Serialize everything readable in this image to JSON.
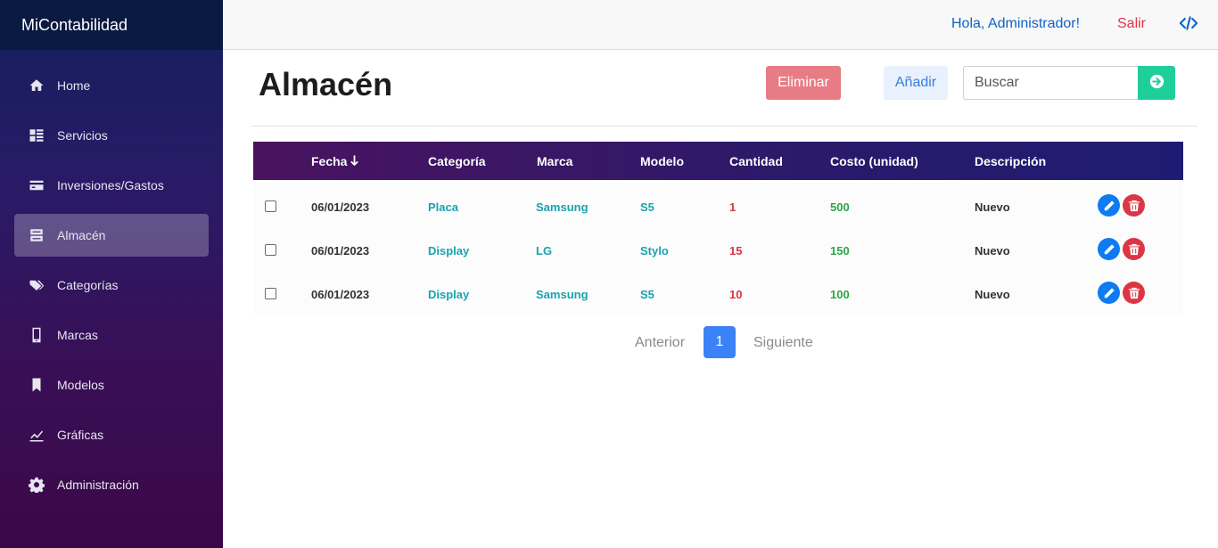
{
  "app": {
    "brand": "MiContabilidad"
  },
  "sidebar": {
    "items": [
      {
        "label": "Home",
        "icon": "home-icon"
      },
      {
        "label": "Servicios",
        "icon": "services-icon"
      },
      {
        "label": "Inversiones/Gastos",
        "icon": "card-icon"
      },
      {
        "label": "Almacén",
        "icon": "storage-icon",
        "active": true
      },
      {
        "label": "Categorías",
        "icon": "tags-icon"
      },
      {
        "label": "Marcas",
        "icon": "phone-icon"
      },
      {
        "label": "Modelos",
        "icon": "bookmark-icon"
      },
      {
        "label": "Gráficas",
        "icon": "chart-icon"
      },
      {
        "label": "Administración",
        "icon": "gear-icon"
      }
    ]
  },
  "topbar": {
    "greeting": "Hola, Administrador!",
    "logout": "Salir",
    "code_icon": "code-icon"
  },
  "page": {
    "title": "Almacén",
    "delete_label": "Eliminar",
    "add_label": "Añadir",
    "search_placeholder": "Buscar"
  },
  "table": {
    "headers": {
      "fecha": "Fecha",
      "categoria": "Categoría",
      "marca": "Marca",
      "modelo": "Modelo",
      "cantidad": "Cantidad",
      "costo": "Costo (unidad)",
      "descripcion": "Descripción"
    },
    "rows": [
      {
        "fecha": "06/01/2023",
        "categoria": "Placa",
        "marca": "Samsung",
        "modelo": "S5",
        "cantidad": "1",
        "costo": "500",
        "descripcion": "Nuevo"
      },
      {
        "fecha": "06/01/2023",
        "categoria": "Display",
        "marca": "LG",
        "modelo": "Stylo",
        "cantidad": "15",
        "costo": "150",
        "descripcion": "Nuevo"
      },
      {
        "fecha": "06/01/2023",
        "categoria": "Display",
        "marca": "Samsung",
        "modelo": "S5",
        "cantidad": "10",
        "costo": "100",
        "descripcion": "Nuevo"
      }
    ]
  },
  "pagination": {
    "prev": "Anterior",
    "current": "1",
    "next": "Siguiente"
  },
  "colors": {
    "accent": "#3b82f6",
    "danger": "#dc3545",
    "success": "#28a745",
    "teal": "#1aa3b0",
    "search_btn": "#1ecf9c"
  }
}
